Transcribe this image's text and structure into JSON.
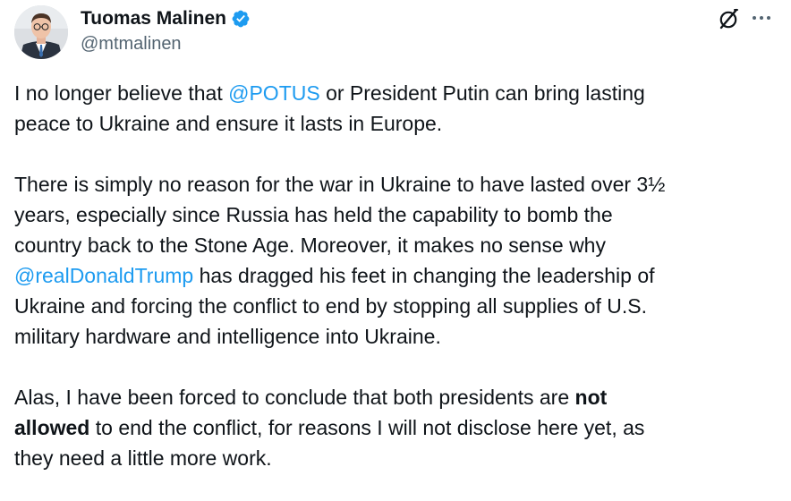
{
  "author": {
    "display_name": "Tuomas Malinen",
    "handle": "@mtmalinen",
    "verified": true,
    "verified_color": "#1d9bf0"
  },
  "header_icons": {
    "grok": "grok-icon",
    "more": "more-icon"
  },
  "colors": {
    "text": "#0f1419",
    "secondary": "#536471",
    "link": "#1d9bf0"
  },
  "tweet": {
    "p1": {
      "line1_before": "I no longer believe that ",
      "mention": "@POTUS",
      "line1_after": " or President Putin can bring lasting",
      "line2": "peace to Ukraine and ensure it lasts in Europe."
    },
    "p2": {
      "line1": "There is simply no reason for the war in Ukraine to have lasted over 3½",
      "line2": "years, especially since Russia has held the capability to bomb the",
      "line3": "country back to the Stone Age. Moreover, it makes no sense why",
      "mention": "@realDonaldTrump",
      "line4_after": " has dragged his feet in changing the leadership of",
      "line5": "Ukraine and forcing the conflict to end by stopping all supplies of U.S.",
      "line6": "military hardware and intelligence into Ukraine."
    },
    "p3": {
      "line1_before": "Alas, I have been forced to conclude that both presidents are ",
      "bold1": "not",
      "bold2": "allowed",
      "line2_after": " to end the conflict, for reasons I will not disclose here yet, as",
      "line3": "they need a little more work."
    }
  }
}
